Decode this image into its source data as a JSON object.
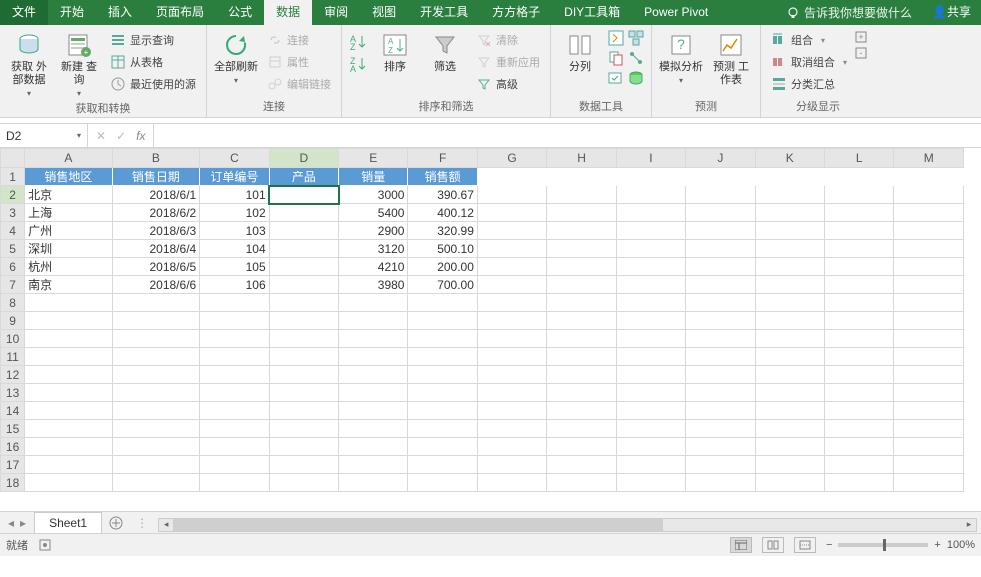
{
  "ribbon_tabs": {
    "file": "文件",
    "items": [
      "开始",
      "插入",
      "页面布局",
      "公式",
      "数据",
      "审阅",
      "视图",
      "开发工具",
      "方方格子",
      "DIY工具箱",
      "Power Pivot"
    ],
    "active_index": 4,
    "tell_me": "告诉我你想要做什么",
    "share": "共享"
  },
  "ribbon": {
    "g1": {
      "label": "获取和转换",
      "get_ext": "获取\n外部数据",
      "new_query": "新建\n查询",
      "show_query": "显示查询",
      "from_table": "从表格",
      "recent": "最近使用的源"
    },
    "g2": {
      "label": "连接",
      "refresh": "全部刷新",
      "conn": "连接",
      "props": "属性",
      "edit": "编辑链接"
    },
    "g3": {
      "label": "排序和筛选",
      "sort": "排序",
      "filter": "筛选",
      "clear": "清除",
      "reapply": "重新应用",
      "adv": "高级"
    },
    "g4": {
      "label": "数据工具",
      "split": "分列"
    },
    "g5": {
      "label": "预测",
      "whatif": "模拟分析",
      "forecast": "预测\n工作表"
    },
    "g6": {
      "label": "分级显示",
      "group": "组合",
      "ungroup": "取消组合",
      "subtotal": "分类汇总"
    }
  },
  "name_box": "D2",
  "formula": "",
  "columns": [
    "A",
    "B",
    "C",
    "D",
    "E",
    "F",
    "G",
    "H",
    "I",
    "J",
    "K",
    "L",
    "M"
  ],
  "header_row": [
    "销售地区",
    "销售日期",
    "订单编号",
    "产品",
    "销量",
    "销售额"
  ],
  "data_rows": [
    {
      "region": "北京",
      "date": "2018/6/1",
      "order": "101",
      "product": "",
      "qty": "3000",
      "amt": "390.67"
    },
    {
      "region": "上海",
      "date": "2018/6/2",
      "order": "102",
      "product": "",
      "qty": "5400",
      "amt": "400.12"
    },
    {
      "region": "广州",
      "date": "2018/6/3",
      "order": "103",
      "product": "",
      "qty": "2900",
      "amt": "320.99"
    },
    {
      "region": "深圳",
      "date": "2018/6/4",
      "order": "104",
      "product": "",
      "qty": "3120",
      "amt": "500.10"
    },
    {
      "region": "杭州",
      "date": "2018/6/5",
      "order": "105",
      "product": "",
      "qty": "4210",
      "amt": "200.00"
    },
    {
      "region": "南京",
      "date": "2018/6/6",
      "order": "106",
      "product": "",
      "qty": "3980",
      "amt": "700.00"
    }
  ],
  "empty_rows": [
    8,
    9,
    10,
    11,
    12,
    13,
    14,
    15,
    16,
    17,
    18
  ],
  "sheet_tab": "Sheet1",
  "status": {
    "ready": "就绪",
    "zoom": "100%"
  },
  "selected": {
    "col": "D",
    "row": 2
  }
}
